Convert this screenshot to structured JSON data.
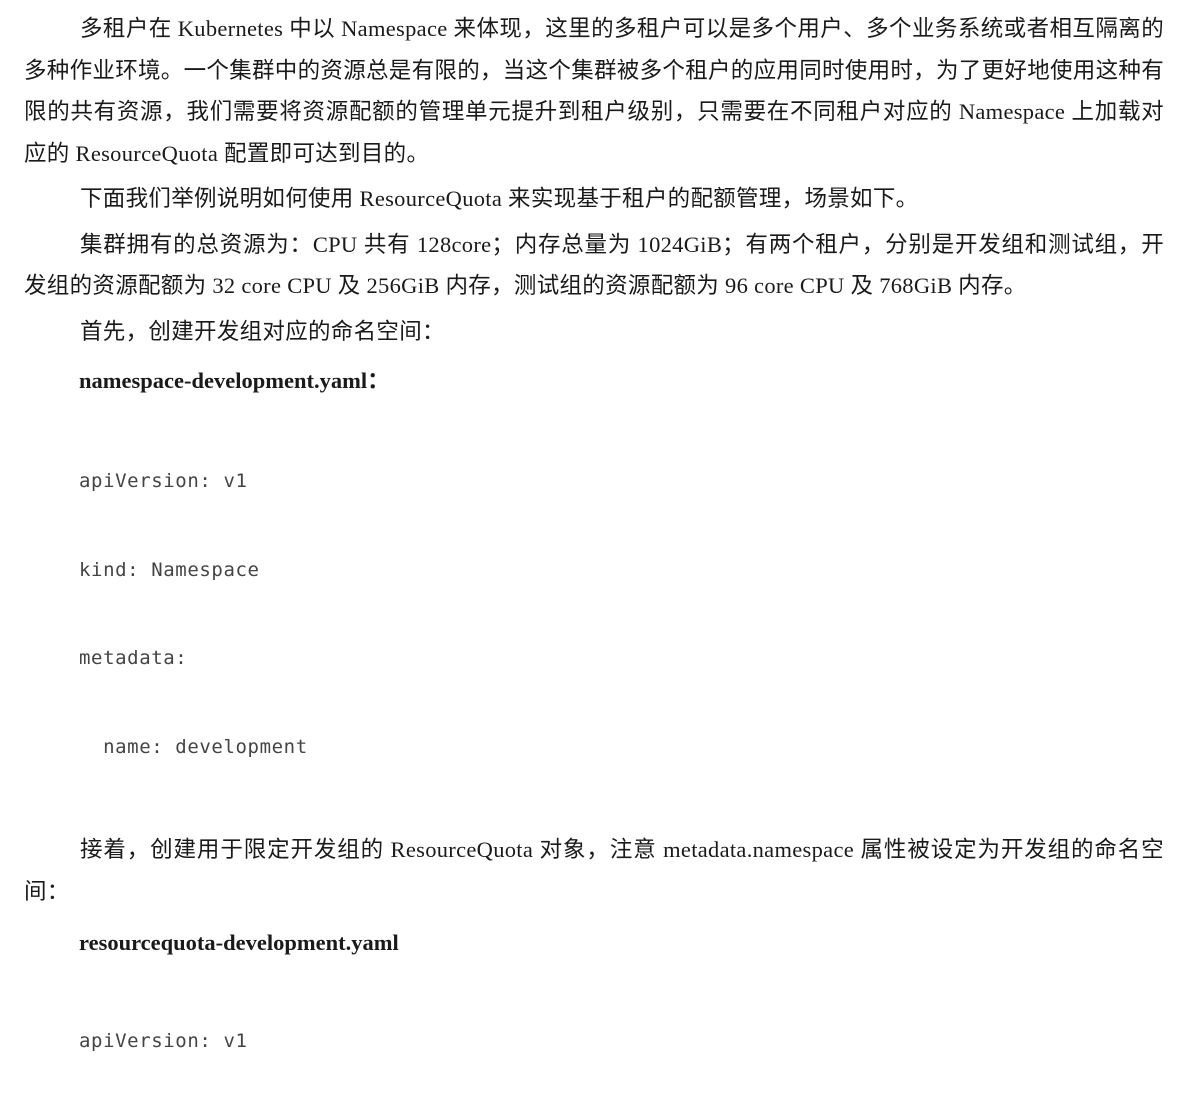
{
  "paragraphs": {
    "p1": "多租户在 Kubernetes 中以 Namespace 来体现，这里的多租户可以是多个用户、多个业务系统或者相互隔离的多种作业环境。一个集群中的资源总是有限的，当这个集群被多个租户的应用同时使用时，为了更好地使用这种有限的共有资源，我们需要将资源配额的管理单元提升到租户级别，只需要在不同租户对应的 Namespace 上加载对应的 ResourceQuota 配置即可达到目的。",
    "p2": "下面我们举例说明如何使用 ResourceQuota 来实现基于租户的配额管理，场景如下。",
    "p3": "集群拥有的总资源为：CPU 共有 128core；内存总量为 1024GiB；有两个租户，分别是开发组和测试组，开发组的资源配额为 32 core CPU 及 256GiB 内存，测试组的资源配额为 96 core CPU 及 768GiB 内存。",
    "p4": "首先，创建开发组对应的命名空间：",
    "p5": "接着，创建用于限定开发组的 ResourceQuota 对象，注意 metadata.namespace 属性被设定为开发组的命名空间："
  },
  "files": {
    "f1": "namespace-development.yaml：",
    "f2": "resourcequota-development.yaml"
  },
  "code1": [
    "apiVersion: v1",
    "kind: Namespace",
    "metadata:",
    "  name: development"
  ],
  "code2": [
    "apiVersion: v1"
  ]
}
